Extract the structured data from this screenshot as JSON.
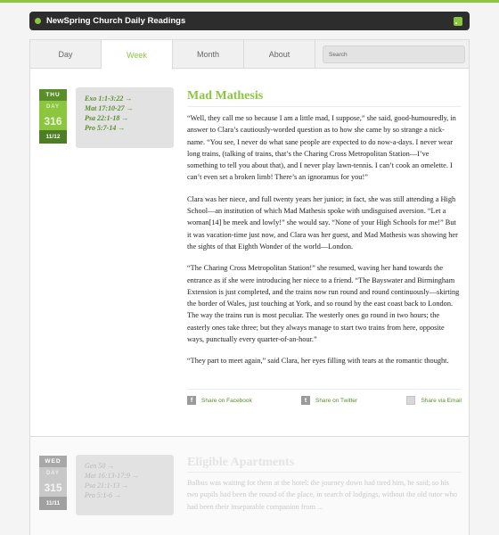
{
  "app": {
    "title": "NewSpring Church Daily Readings",
    "rss_icon": "rss-icon"
  },
  "tabs": [
    {
      "label": "Day",
      "active": false
    },
    {
      "label": "Week",
      "active": true
    },
    {
      "label": "Month",
      "active": false
    },
    {
      "label": "About",
      "active": false
    }
  ],
  "search": {
    "placeholder": "Search"
  },
  "entries": [
    {
      "badge": {
        "dow": "THU",
        "day_label": "DAY",
        "day_number": "316",
        "date": "11/12"
      },
      "references": [
        "Exo 1:1-3:22 →",
        "Mat 17:10-27 →",
        "Psa 22:1-18 →",
        "Pro 5:7-14 →"
      ],
      "title": "Mad Mathesis",
      "paragraphs": [
        "“Well, they call me so because I am a little mad, I suppose,” she said, good-humouredly, in answer to Clara’s cautiously-worded question as to how she came by so strange a nick-name. “You see, I never do what sane people are expected to do now-a-days. I never wear long trains, (talking of trains, that’s the Charing Cross Metropolitan Station—I’ve something to tell you about that), and I never play lawn-tennis. I can’t cook an omelette. I can’t even set a broken limb! There’s an ignoramus for you!”",
        "Clara was her niece, and full twenty years her junior; in fact, she was still attending a High School—an institution of which Mad Mathesis spoke with undisguised aversion. “Let a woman[14] be meek and lowly!” she would say. “None of your High Schools for me!” But it was vacation-time just now, and Clara was her guest, and Mad Mathesis was showing her the sights of that Eighth Wonder of the world—London.",
        "“The Charing Cross Metropolitan Station!” she resumed, waving her hand towards the entrance as if she were introducing her niece to a friend. “The Bayswater and Birmingham Extension is just completed, and the trains now run round and round continuously—skirting the border of Wales, just touching at York, and so round by the east coast back to London. The way the trains run is most peculiar. The westerly ones go round in two hours; the easterly ones take three; but they always manage to start two trains from here, opposite ways, punctually every quarter-of-an-hour.”",
        "“They part to meet again,” said Clara, her eyes filling with tears at the romantic thought."
      ],
      "share": {
        "facebook": {
          "label": "Share on Facebook",
          "icon": "f"
        },
        "twitter": {
          "label": "Share on Twitter",
          "icon": "t"
        },
        "email": {
          "label": "Share via Email"
        }
      }
    },
    {
      "badge": {
        "dow": "WED",
        "day_label": "DAY",
        "day_number": "315",
        "date": "11/11"
      },
      "references": [
        "Gen 50 →",
        "Mat 16:13-17:9 →",
        "Psa 21:1-13 →",
        "Pro 5:1-6 →"
      ],
      "title": "Eligible Apartments",
      "excerpt": "Balbus was waiting for them at the hotel: the journey down had tired him, he said; so his two pupils had been the round of the place, in search of lodgings, without the old tutor who had been their inseparable companion from ..."
    }
  ]
}
